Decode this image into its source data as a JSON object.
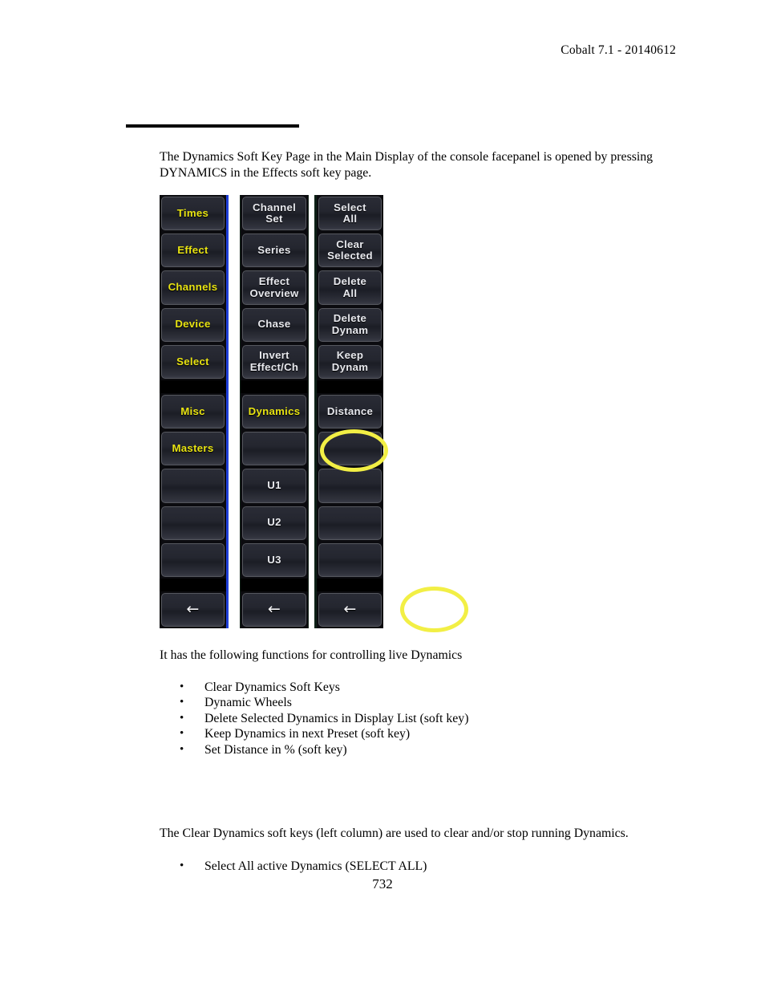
{
  "header": {
    "revision": "Cobalt 7.1 - 20140612"
  },
  "page": {
    "number": "732"
  },
  "content": {
    "intro_paragraph": "The Dynamics Soft Key Page in the Main Display of the console facepanel is opened by pressing DYNAMICS in the Effects soft key page.",
    "functions_intro": "It has the following functions for controlling live Dynamics",
    "functions_list": [
      "Clear Dynamics Soft Keys",
      "Dynamic Wheels",
      "Delete Selected Dynamics in Display List (soft key)",
      "Keep Dynamics in next Preset (soft key)",
      "Set Distance in % (soft key)"
    ],
    "clear_dynamics_paragraph": "The Clear Dynamics soft keys (left column) are used to clear and/or stop running Dynamics.",
    "clear_dynamics_list": [
      "Select All active Dynamics (SELECT ALL)"
    ],
    "bullet_glyph": "•"
  },
  "softkey_panel": {
    "accent_colors": {
      "left_border": "#1f3fd8",
      "right_border": "#0d2016",
      "annotation": "#f2ef45",
      "yellow_label": "#e8e312",
      "white_label": "#e8e9ee"
    },
    "back_arrow_glyph": "←",
    "columns": [
      {
        "name": "left",
        "keys": [
          {
            "label": "Times",
            "style": "yellow"
          },
          {
            "label": "Effect",
            "style": "yellow",
            "highlighted": true
          },
          {
            "label": "Channels",
            "style": "yellow"
          },
          {
            "label": "Device",
            "style": "yellow"
          },
          {
            "label": "Select",
            "style": "yellow"
          },
          {
            "label": "",
            "style": "gap"
          },
          {
            "label": "Misc",
            "style": "yellow"
          },
          {
            "label": "Masters",
            "style": "yellow"
          },
          {
            "label": "",
            "style": "empty"
          },
          {
            "label": "",
            "style": "empty"
          },
          {
            "label": "",
            "style": "empty"
          },
          {
            "label": "",
            "style": "gap"
          },
          {
            "label": "←",
            "style": "arrow"
          }
        ]
      },
      {
        "name": "middle",
        "keys": [
          {
            "label": "Channel Set",
            "style": "white"
          },
          {
            "label": "Series",
            "style": "white"
          },
          {
            "label": "Effect Overview",
            "style": "white"
          },
          {
            "label": "Chase",
            "style": "white"
          },
          {
            "label": "Invert Effect/Ch",
            "style": "white"
          },
          {
            "label": "",
            "style": "gap"
          },
          {
            "label": "Dynamics",
            "style": "yellow",
            "highlighted": true
          },
          {
            "label": "",
            "style": "empty"
          },
          {
            "label": "U1",
            "style": "white"
          },
          {
            "label": "U2",
            "style": "white"
          },
          {
            "label": "U3",
            "style": "white"
          },
          {
            "label": "",
            "style": "gap"
          },
          {
            "label": "←",
            "style": "arrow"
          }
        ]
      },
      {
        "name": "right",
        "keys": [
          {
            "label": "Select All",
            "style": "white"
          },
          {
            "label": "Clear Selected",
            "style": "white"
          },
          {
            "label": "Delete All",
            "style": "white"
          },
          {
            "label": "Delete Dynam",
            "style": "white"
          },
          {
            "label": "Keep Dynam",
            "style": "white"
          },
          {
            "label": "",
            "style": "gap"
          },
          {
            "label": "Distance",
            "style": "white"
          },
          {
            "label": "",
            "style": "empty"
          },
          {
            "label": "",
            "style": "empty"
          },
          {
            "label": "",
            "style": "empty"
          },
          {
            "label": "",
            "style": "empty"
          },
          {
            "label": "",
            "style": "gap"
          },
          {
            "label": "←",
            "style": "arrow"
          }
        ]
      }
    ]
  }
}
